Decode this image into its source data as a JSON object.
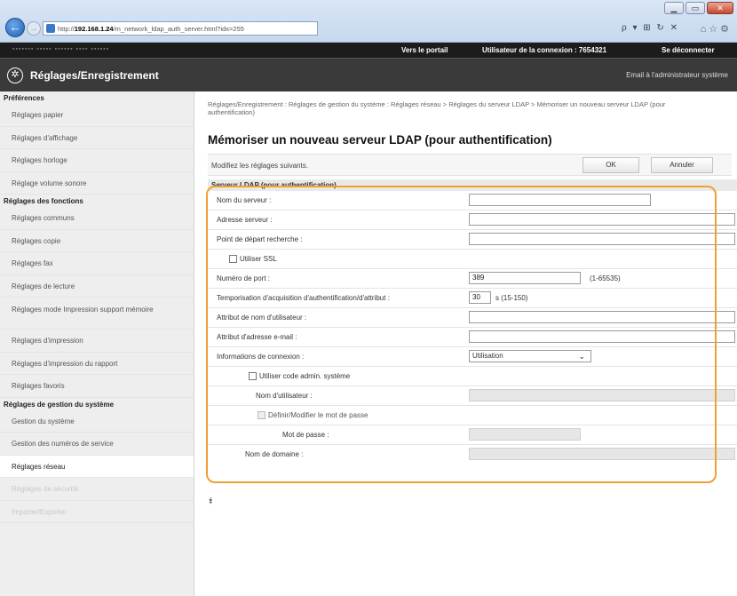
{
  "browser": {
    "address_prefix": "http://",
    "address_host": "192.168.1.24",
    "address_path": "/m_network_ldap_auth_server.html?idx=255",
    "search_icons": "ρ ▾ ⊞ ↻ ✕",
    "window": {
      "minimize": "▁",
      "maximize": "▭",
      "close": "✕"
    }
  },
  "topbar": {
    "device_name": "▪▪▪▪▪▪▪   ▪▪▪▪▪ ▪▪▪▪▪▪ ▪▪▪▪ ▪▪▪▪▪▪",
    "portal": "Vers le portail",
    "user": "Utilisateur de la connexion : 7654321",
    "logout": "Se déconnecter"
  },
  "header": {
    "title": "Réglages/Enregistrement",
    "email_admin": "Email à l'administrateur système"
  },
  "sidebar": {
    "sections": [
      {
        "title": "Préférences",
        "items": [
          "Réglages papier",
          "Réglages d'affichage",
          "Réglages horloge",
          "Réglage volume sonore"
        ]
      },
      {
        "title": "Réglages des fonctions",
        "items": [
          "Réglages communs",
          "Réglages copie",
          "Réglages fax",
          "Réglages de lecture",
          "Réglages mode Impression support mémoire",
          "Réglages d'impression",
          "Réglages d'impression du rapport",
          "Réglages favoris"
        ]
      },
      {
        "title": "Réglages de gestion du système",
        "items": [
          "Gestion du système",
          "Gestion des numéros de service",
          "Réglages réseau",
          "Réglages de sécurité",
          "Importer/Exporter"
        ]
      }
    ]
  },
  "main": {
    "breadcrumb": "Réglages/Enregistrement : Réglages de gestion du système : Réglages réseau > Réglages du serveur LDAP > Mémoriser un nouveau serveur LDAP (pour authentification)",
    "title": "Mémoriser un nouveau serveur LDAP (pour authentification)",
    "instruction": "Modifiez les réglages suivants.",
    "ok": "OK",
    "cancel": "Annuler",
    "section_title": "Serveur LDAP (pour authentification)",
    "fields": {
      "server_name": "Nom du serveur :",
      "server_address": "Adresse serveur :",
      "search_root": "Point de départ recherche :",
      "use_ssl": "Utiliser SSL",
      "port_number": "Numéro de port :",
      "port_value": "389",
      "port_range": "(1-65535)",
      "timeout": "Temporisation d'acquisition d'authentification/d'attribut :",
      "timeout_value": "30",
      "timeout_range": "s (15-150)",
      "user_attr": "Attribut de nom d'utilisateur :",
      "email_attr": "Attribut d'adresse e-mail :",
      "login_info": "Informations de connexion :",
      "login_info_value": "Utilisation",
      "use_admin_code": "Utiliser code admin. système",
      "username": "Nom d'utilisateur :",
      "set_password": "Définir/Modifier le mot de passe",
      "password": "Mot de passe :",
      "domain": "Nom de domaine :"
    },
    "back_to_top": "⯒"
  },
  "colors": {
    "highlight": "#f0a030",
    "header_bg": "#3a3a3a",
    "topbar_bg": "#1c1c1c"
  }
}
